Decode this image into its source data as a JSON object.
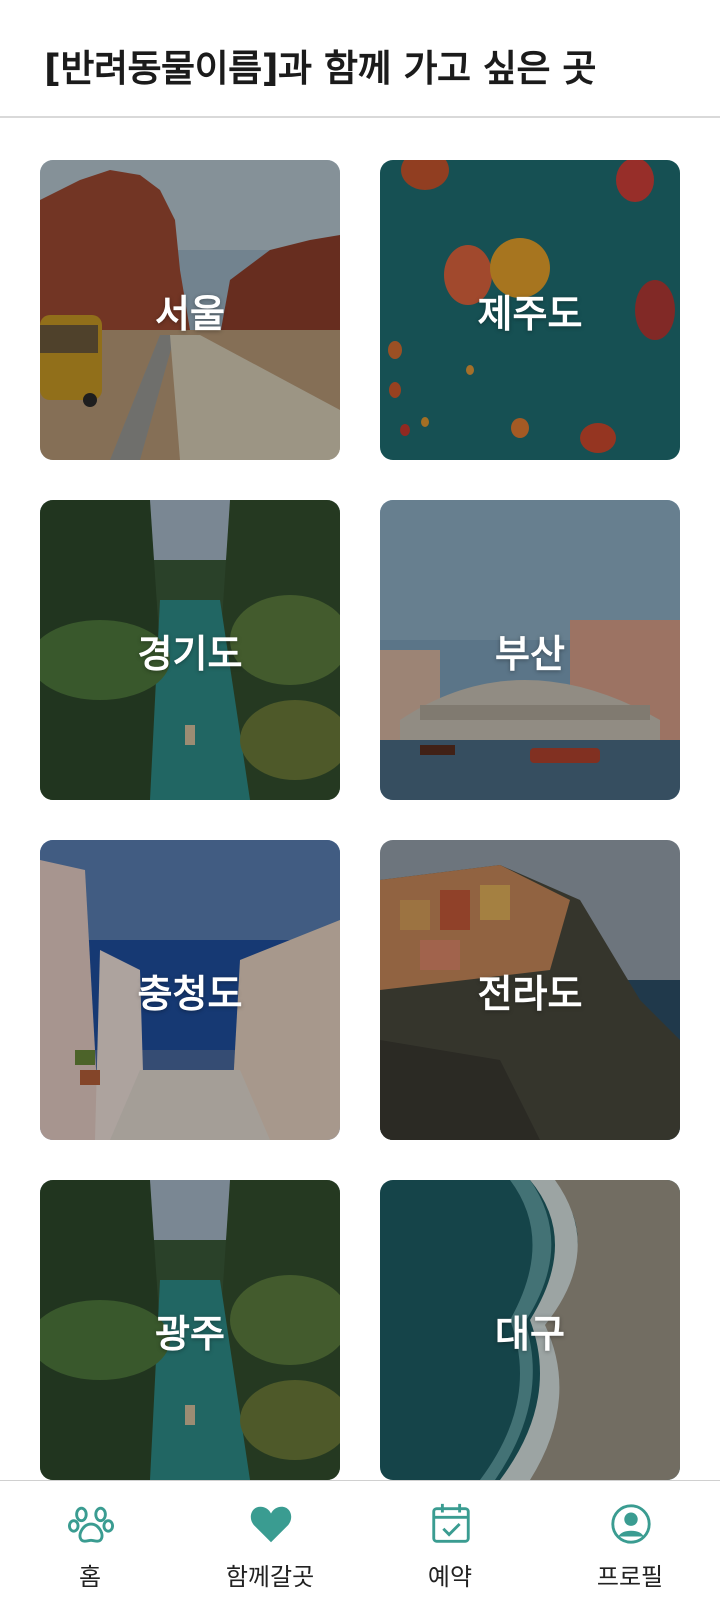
{
  "header": {
    "title": "[반려동물이름]과 함께 가고 싶은 곳"
  },
  "regions": [
    {
      "label": "서울"
    },
    {
      "label": "제주도"
    },
    {
      "label": "경기도"
    },
    {
      "label": "부산"
    },
    {
      "label": "충청도"
    },
    {
      "label": "전라도"
    },
    {
      "label": "광주"
    },
    {
      "label": "대구"
    }
  ],
  "tabbar": {
    "items": [
      {
        "label": "홈",
        "icon": "paw-icon"
      },
      {
        "label": "함께갈곳",
        "icon": "heart-icon"
      },
      {
        "label": "예약",
        "icon": "calendar-check-icon"
      },
      {
        "label": "프로필",
        "icon": "user-circle-icon"
      }
    ],
    "accent": "#3a9c91"
  }
}
